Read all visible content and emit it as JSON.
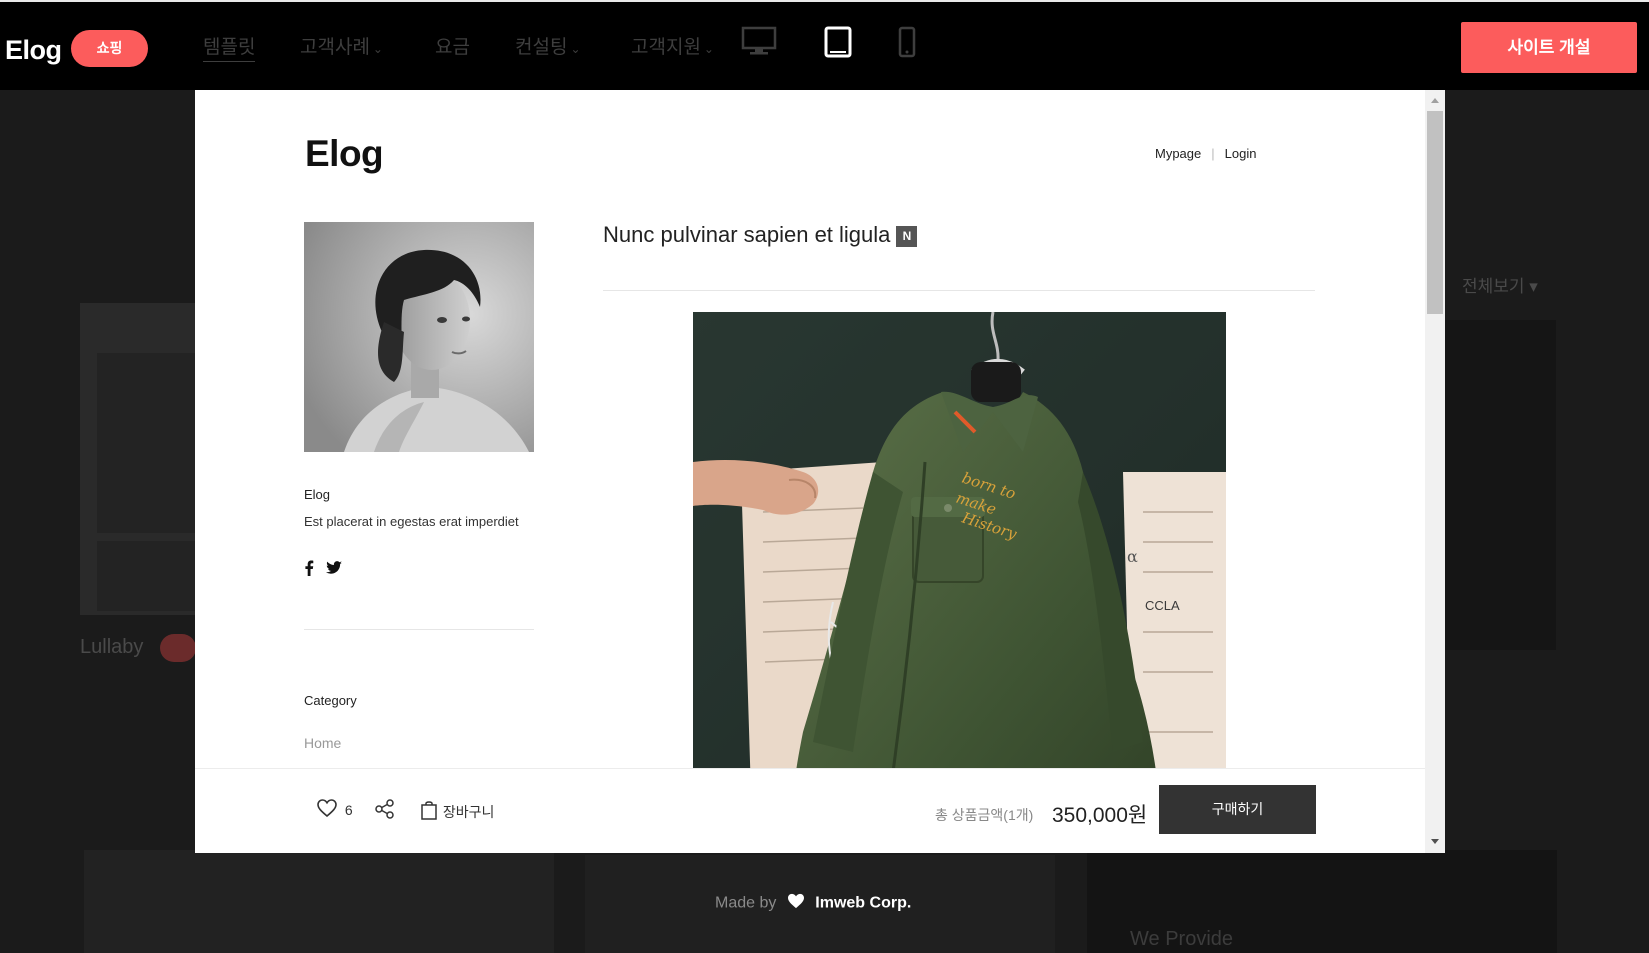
{
  "header": {
    "logo": "Elog",
    "badge": "쇼핑",
    "nav": [
      {
        "label": "템플릿",
        "has_dropdown": false
      },
      {
        "label": "고객사례",
        "has_dropdown": true
      },
      {
        "label": "요금",
        "has_dropdown": false
      },
      {
        "label": "컨설팅",
        "has_dropdown": true
      },
      {
        "label": "고객지원",
        "has_dropdown": true
      }
    ],
    "devices": [
      "desktop-icon",
      "tablet-icon",
      "mobile-icon"
    ],
    "active_device": "tablet-icon",
    "cta_label": "사이트 개설",
    "accent_color": "#fc5c5c"
  },
  "background": {
    "card_title": "Lullaby",
    "filter_label": "전체보기 ▾",
    "provide_text": "We Provide"
  },
  "preview": {
    "logo": "Elog",
    "links": {
      "mypage": "Mypage",
      "login": "Login"
    },
    "profile": {
      "name": "Elog",
      "description": "Est placerat in egestas erat imperdiet"
    },
    "social": [
      "facebook-icon",
      "twitter-icon"
    ],
    "category_label": "Category",
    "category_items": [
      "Home"
    ],
    "post": {
      "title": "Nunc pulvinar sapien et ligula",
      "new_badge": "N"
    },
    "actions": {
      "like_count": "6",
      "cart_label": "장바구니",
      "total_label": "총 상품금액(1개)",
      "price": "350,000원",
      "buy_label": "구매하기"
    }
  },
  "footer": {
    "made_by": "Made by",
    "company": "Imweb Corp."
  }
}
